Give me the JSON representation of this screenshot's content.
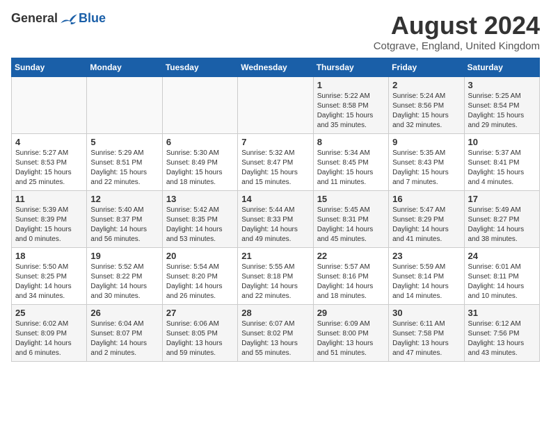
{
  "logo": {
    "general": "General",
    "blue": "Blue"
  },
  "header": {
    "month": "August 2024",
    "location": "Cotgrave, England, United Kingdom"
  },
  "weekdays": [
    "Sunday",
    "Monday",
    "Tuesday",
    "Wednesday",
    "Thursday",
    "Friday",
    "Saturday"
  ],
  "weeks": [
    [
      {
        "day": "",
        "info": ""
      },
      {
        "day": "",
        "info": ""
      },
      {
        "day": "",
        "info": ""
      },
      {
        "day": "",
        "info": ""
      },
      {
        "day": "1",
        "info": "Sunrise: 5:22 AM\nSunset: 8:58 PM\nDaylight: 15 hours\nand 35 minutes."
      },
      {
        "day": "2",
        "info": "Sunrise: 5:24 AM\nSunset: 8:56 PM\nDaylight: 15 hours\nand 32 minutes."
      },
      {
        "day": "3",
        "info": "Sunrise: 5:25 AM\nSunset: 8:54 PM\nDaylight: 15 hours\nand 29 minutes."
      }
    ],
    [
      {
        "day": "4",
        "info": "Sunrise: 5:27 AM\nSunset: 8:53 PM\nDaylight: 15 hours\nand 25 minutes."
      },
      {
        "day": "5",
        "info": "Sunrise: 5:29 AM\nSunset: 8:51 PM\nDaylight: 15 hours\nand 22 minutes."
      },
      {
        "day": "6",
        "info": "Sunrise: 5:30 AM\nSunset: 8:49 PM\nDaylight: 15 hours\nand 18 minutes."
      },
      {
        "day": "7",
        "info": "Sunrise: 5:32 AM\nSunset: 8:47 PM\nDaylight: 15 hours\nand 15 minutes."
      },
      {
        "day": "8",
        "info": "Sunrise: 5:34 AM\nSunset: 8:45 PM\nDaylight: 15 hours\nand 11 minutes."
      },
      {
        "day": "9",
        "info": "Sunrise: 5:35 AM\nSunset: 8:43 PM\nDaylight: 15 hours\nand 7 minutes."
      },
      {
        "day": "10",
        "info": "Sunrise: 5:37 AM\nSunset: 8:41 PM\nDaylight: 15 hours\nand 4 minutes."
      }
    ],
    [
      {
        "day": "11",
        "info": "Sunrise: 5:39 AM\nSunset: 8:39 PM\nDaylight: 15 hours\nand 0 minutes."
      },
      {
        "day": "12",
        "info": "Sunrise: 5:40 AM\nSunset: 8:37 PM\nDaylight: 14 hours\nand 56 minutes."
      },
      {
        "day": "13",
        "info": "Sunrise: 5:42 AM\nSunset: 8:35 PM\nDaylight: 14 hours\nand 53 minutes."
      },
      {
        "day": "14",
        "info": "Sunrise: 5:44 AM\nSunset: 8:33 PM\nDaylight: 14 hours\nand 49 minutes."
      },
      {
        "day": "15",
        "info": "Sunrise: 5:45 AM\nSunset: 8:31 PM\nDaylight: 14 hours\nand 45 minutes."
      },
      {
        "day": "16",
        "info": "Sunrise: 5:47 AM\nSunset: 8:29 PM\nDaylight: 14 hours\nand 41 minutes."
      },
      {
        "day": "17",
        "info": "Sunrise: 5:49 AM\nSunset: 8:27 PM\nDaylight: 14 hours\nand 38 minutes."
      }
    ],
    [
      {
        "day": "18",
        "info": "Sunrise: 5:50 AM\nSunset: 8:25 PM\nDaylight: 14 hours\nand 34 minutes."
      },
      {
        "day": "19",
        "info": "Sunrise: 5:52 AM\nSunset: 8:22 PM\nDaylight: 14 hours\nand 30 minutes."
      },
      {
        "day": "20",
        "info": "Sunrise: 5:54 AM\nSunset: 8:20 PM\nDaylight: 14 hours\nand 26 minutes."
      },
      {
        "day": "21",
        "info": "Sunrise: 5:55 AM\nSunset: 8:18 PM\nDaylight: 14 hours\nand 22 minutes."
      },
      {
        "day": "22",
        "info": "Sunrise: 5:57 AM\nSunset: 8:16 PM\nDaylight: 14 hours\nand 18 minutes."
      },
      {
        "day": "23",
        "info": "Sunrise: 5:59 AM\nSunset: 8:14 PM\nDaylight: 14 hours\nand 14 minutes."
      },
      {
        "day": "24",
        "info": "Sunrise: 6:01 AM\nSunset: 8:11 PM\nDaylight: 14 hours\nand 10 minutes."
      }
    ],
    [
      {
        "day": "25",
        "info": "Sunrise: 6:02 AM\nSunset: 8:09 PM\nDaylight: 14 hours\nand 6 minutes."
      },
      {
        "day": "26",
        "info": "Sunrise: 6:04 AM\nSunset: 8:07 PM\nDaylight: 14 hours\nand 2 minutes."
      },
      {
        "day": "27",
        "info": "Sunrise: 6:06 AM\nSunset: 8:05 PM\nDaylight: 13 hours\nand 59 minutes."
      },
      {
        "day": "28",
        "info": "Sunrise: 6:07 AM\nSunset: 8:02 PM\nDaylight: 13 hours\nand 55 minutes."
      },
      {
        "day": "29",
        "info": "Sunrise: 6:09 AM\nSunset: 8:00 PM\nDaylight: 13 hours\nand 51 minutes."
      },
      {
        "day": "30",
        "info": "Sunrise: 6:11 AM\nSunset: 7:58 PM\nDaylight: 13 hours\nand 47 minutes."
      },
      {
        "day": "31",
        "info": "Sunrise: 6:12 AM\nSunset: 7:56 PM\nDaylight: 13 hours\nand 43 minutes."
      }
    ]
  ]
}
